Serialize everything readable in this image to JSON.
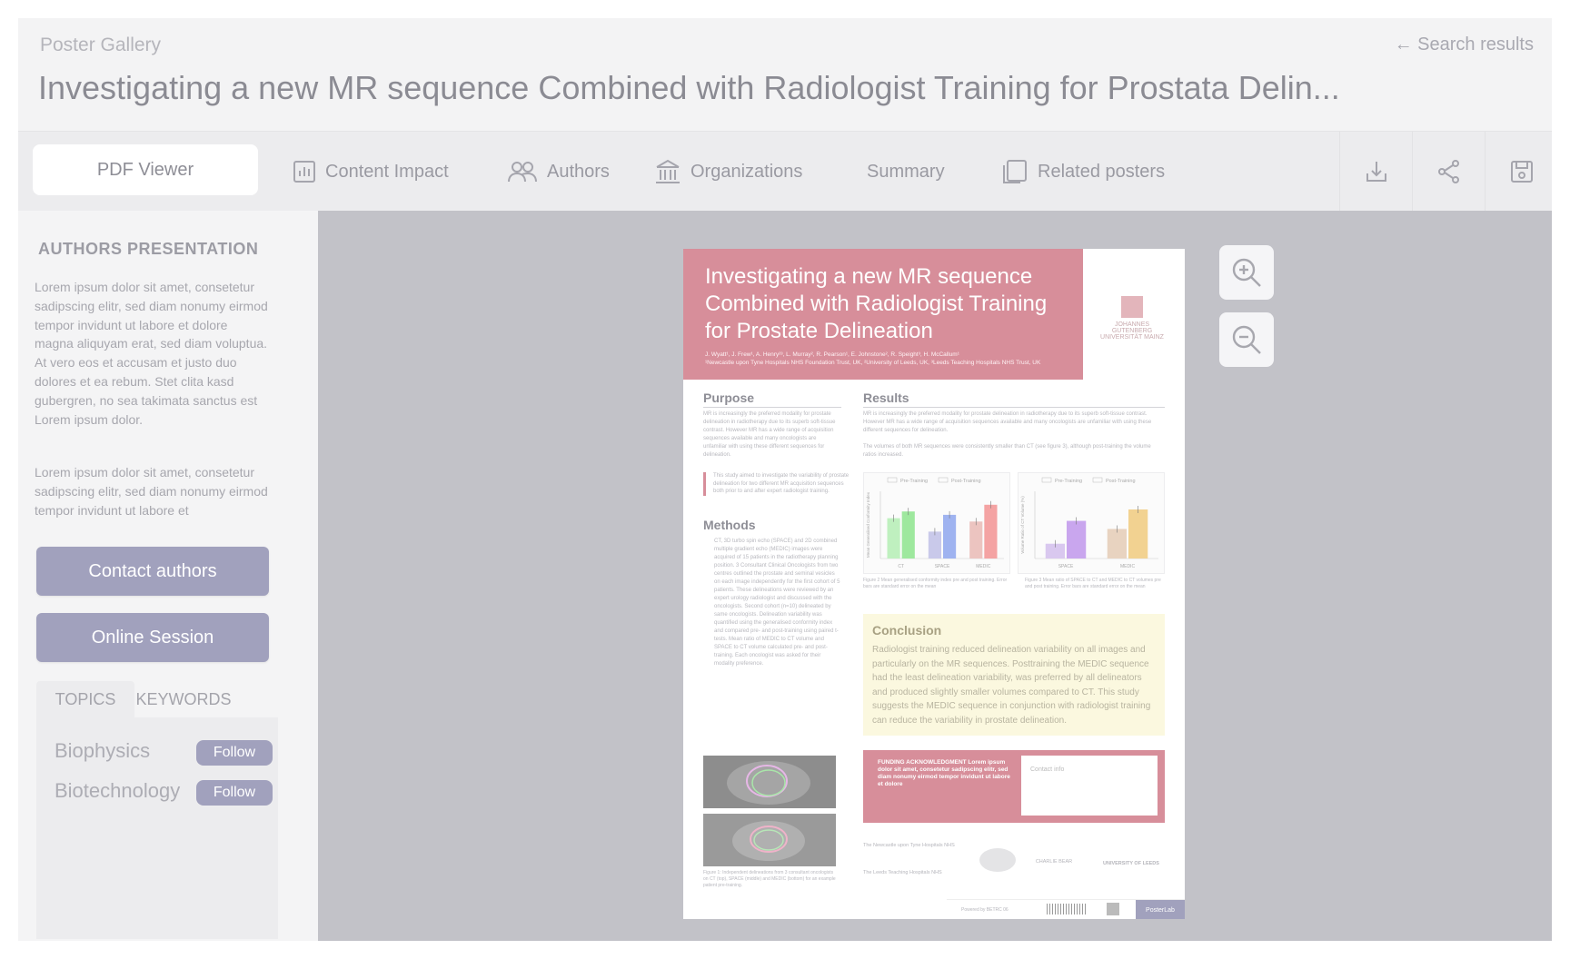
{
  "header": {
    "breadcrumb": "Poster Gallery",
    "back_link": "Search results",
    "title": "Investigating a new MR sequence Combined with Radiologist Training for Prostata Delin..."
  },
  "tabs": [
    {
      "label": "PDF Viewer",
      "icon": "none"
    },
    {
      "label": "Content Impact",
      "icon": "bar-chart-icon"
    },
    {
      "label": "Authors",
      "icon": "people-icon"
    },
    {
      "label": "Organizations",
      "icon": "building-icon"
    },
    {
      "label": "Summary",
      "icon": "none"
    },
    {
      "label": "Related posters",
      "icon": "copy-icon"
    }
  ],
  "toolbar": {
    "icons": [
      "download-icon",
      "share-icon",
      "save-icon"
    ]
  },
  "sidebar": {
    "heading": "AUTHORS PRESENTATION",
    "paragraphs": [
      "Lorem ipsum dolor sit amet, consetetur sadipscing elitr, sed diam nonumy eirmod tempor invidunt ut labore et dolore magna aliquyam erat, sed diam voluptua. At vero eos et accusam et justo duo dolores et ea rebum. Stet clita kasd gubergren, no sea takimata sanctus est Lorem ipsum dolor.",
      "Lorem ipsum dolor sit amet, consetetur sadipscing elitr, sed diam nonumy eirmod tempor invidunt ut labore et"
    ],
    "contact_button": "Contact authors",
    "session_button": "Online Session",
    "topic_tabs": [
      "TOPICS",
      "KEYWORDS"
    ],
    "topics": [
      {
        "name": "Biophysics",
        "follow": "Follow"
      },
      {
        "name": "Biotechnology",
        "follow": "Follow"
      }
    ]
  },
  "poster": {
    "title": "Investigating a new MR sequence Combined with Radiologist Training for Prostate Delineation",
    "authors": "J. Wyatt¹, J. Frew¹, A. Henry²³, L. Murray², R. Pearson¹, E. Johnstone², R. Speight³, H. McCallum¹",
    "affiliations": "¹Newcastle upon Tyne Hospitals NHS Foundation Trust, UK, ²University of Leeds, UK, ³Leeds Teaching Hospitals NHS Trust, UK",
    "logo_text": "JOHANNES GUTENBERG UNIVERSITÄT MAINZ",
    "purpose_heading": "Purpose",
    "purpose_text": "MR is increasingly the preferred modality for prostate delineation in radiotherapy due to its superb soft-tissue contrast. However MR has a wide range of acquisition sequences available and many oncologists are unfamiliar with using these different sequences for delineation.",
    "purpose_quote": "This study aimed to investigate the variability of prostate delineation for two different MR acquisition sequences both prior to and after expert radiologist training.",
    "methods_heading": "Methods",
    "methods_text": "CT, 3D turbo spin echo (SPACE) and 2D combined multiple gradient echo (MEDIC) images were acquired of 15 patients in the radiotherapy planning position. 3 Consultant Clinical Oncologists from two centres outlined the prostate and seminal vesicles on each image independently for the first cohort of 5 patients. These delineations were reviewed by an expert urology radiologist and discussed with the oncologists. Second cohort (n=10) delineated by same oncologists. Delineation variability was quantified using the generalised conformity index and compared pre- and post-training using paired t-tests. Mean ratio of MEDIC to CT volume and SPACE to CT volume calculated pre- and post-training. Each oncologist was asked for their modality preference.",
    "figure1_caption": "Figure 1: Independent delineations from 3 consultant oncologists on CT (top), SPACE (middle) and MEDIC (bottom) for an example patient pre-training.",
    "results_heading": "Results",
    "results_text": "MR is increasingly the preferred modality for prostate delineation in radiotherapy due to its superb soft-tissue contrast. However MR has a wide range of acquisition sequences available and many oncologists are unfamiliar with using these different sequences for delineation.",
    "results_text2": "The volumes of both MR sequences were consistently smaller than CT (see figure 3), although post-training the volume ratios increased.",
    "figure2_caption": "Figure 2 Mean generalised conformity index pre and post training. Error bars are standard error on the mean",
    "figure3_caption": "Figure 3 Mean ratio of SPACE to CT and MEDIC to CT volumes pre and post training. Error bars are standard error on the mean",
    "conclusion_heading": "Conclusion",
    "conclusion_text": "Radiologist training reduced delineation variability on all images and particularly on the MR sequences. Posttraining the MEDIC sequence had the least delineation variability, was preferred by all delineators and produced slightly smaller volumes compared to CT. This study suggests the MEDIC sequence in conjunction with radiologist training can reduce the variability in prostate delineation.",
    "funding_text": "FUNDING ACKNOWLEDGMENT Lorem ipsum dolor sit amet, consetetur sadipscing elitr, sed diam nonumy eirmod tempor invidunt ut labore et dolore",
    "contact_text": "Contact info",
    "logo1": "The Newcastle upon Tyne Hospitals NHS",
    "logo2": "The Leeds Teaching Hospitals NHS",
    "logo3": "CHARLIE BEAR",
    "logo4": "UNIVERSITY OF LEEDS",
    "footer_text": "Powered by BETRC 06",
    "posterlab": "PosterLab"
  },
  "chart_data": [
    {
      "type": "bar",
      "title": "",
      "ylabel": "Mean Generalised Conformity Index",
      "categories": [
        "CT",
        "SPACE",
        "MEDIC"
      ],
      "ylim": [
        0.7,
        0.9
      ],
      "series": [
        {
          "name": "Pre-Training",
          "values": [
            0.82,
            0.78,
            0.81
          ]
        },
        {
          "name": "Post-Training",
          "values": [
            0.84,
            0.83,
            0.86
          ]
        }
      ],
      "colors": {
        "pre": [
          "#bff0bf",
          "#c9c9ea",
          "#ecc4c0"
        ],
        "post": [
          "#9ee89e",
          "#9fb3f0",
          "#f4a3a3"
        ]
      }
    },
    {
      "type": "bar",
      "title": "",
      "ylabel": "Volume Ratio of CT Volume (%)",
      "categories": [
        "SPACE",
        "MEDIC"
      ],
      "ylim": [
        0,
        100
      ],
      "series": [
        {
          "name": "Pre-Training",
          "values": [
            22,
            44
          ]
        },
        {
          "name": "Post-Training",
          "values": [
            56,
            73
          ]
        }
      ],
      "colors": {
        "pre": [
          "#d9c8ef",
          "#e8d3c0"
        ],
        "post": [
          "#c9a6ee",
          "#f2d291"
        ]
      }
    }
  ]
}
